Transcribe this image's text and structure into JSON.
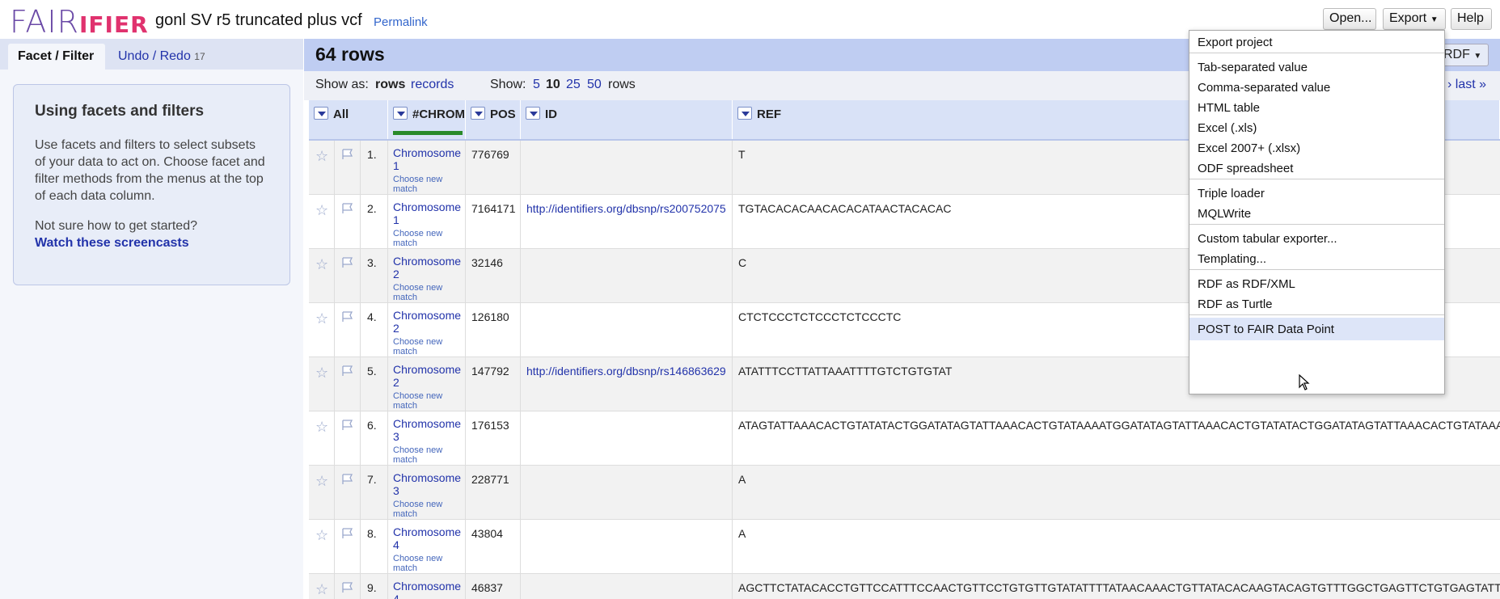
{
  "header": {
    "logo_fair": "FAIR",
    "logo_ifier": "IFIER",
    "project_title": "gonl SV r5 truncated plus vcf",
    "permalink": "Permalink",
    "open_label": "Open...",
    "export_label": "Export",
    "help_label": "Help"
  },
  "left": {
    "tab_facet": "Facet / Filter",
    "tab_undo": "Undo / Redo",
    "undo_count": "17",
    "help_title": "Using facets and filters",
    "help_body": "Use facets and filters to select subsets of your data to act on. Choose facet and filter methods from the menus at the top of each data column.",
    "help_question": "Not sure how to get started?",
    "help_link": "Watch these screencasts"
  },
  "grid": {
    "row_count": "64 rows",
    "rdf_button": "RDF",
    "show_as": "Show as:",
    "opt_rows": "rows",
    "opt_records": "records",
    "show": "Show:",
    "page_sizes": [
      "5",
      "10",
      "25",
      "50"
    ],
    "rows_label": "rows",
    "pager": "›  last »",
    "columns": [
      "All",
      "#CHROM",
      "POS",
      "ID",
      "REF"
    ],
    "choose_text": "Choose new match",
    "rows": [
      {
        "idx": "1.",
        "chrom": "Chromosome 1",
        "pos": "776769",
        "id": "",
        "ref": "T"
      },
      {
        "idx": "2.",
        "chrom": "Chromosome 1",
        "pos": "7164171",
        "id": "http://identifiers.org/dbsnp/rs200752075",
        "ref": "TGTACACACAACACACATAACTACACAC"
      },
      {
        "idx": "3.",
        "chrom": "Chromosome 2",
        "pos": "32146",
        "id": "",
        "ref": "C"
      },
      {
        "idx": "4.",
        "chrom": "Chromosome 2",
        "pos": "126180",
        "id": "",
        "ref": "CTCTCCCTCTCCCTCTCCCTC"
      },
      {
        "idx": "5.",
        "chrom": "Chromosome 2",
        "pos": "147792",
        "id": "http://identifiers.org/dbsnp/rs146863629",
        "ref": "ATATTTCCTTATTAAATTTTGTCTGTGTAT"
      },
      {
        "idx": "6.",
        "chrom": "Chromosome 3",
        "pos": "176153",
        "id": "",
        "ref": "ATAGTATTAAACACTGTATATACTGGATATAGTATTAAACACTGTATAAAATGGATATAGTATTAAACACTGTATATACTGGATATAGTATTAAACACTGTATAAA"
      },
      {
        "idx": "7.",
        "chrom": "Chromosome 3",
        "pos": "228771",
        "id": "",
        "ref": "A"
      },
      {
        "idx": "8.",
        "chrom": "Chromosome 4",
        "pos": "43804",
        "id": "",
        "ref": "A"
      },
      {
        "idx": "9.",
        "chrom": "Chromosome 4",
        "pos": "46837",
        "id": "",
        "ref": "AGCTTCTATACACCTGTTCCATTTCCAACTGTTCCTGTGTTGTATATTTTATAACAAACTGTTATACACAAGTACAGTGTTTGGCTGAGTTCTGTGAGTATT"
      }
    ]
  },
  "export_menu": {
    "items": [
      "Export project",
      "Tab-separated value",
      "Comma-separated value",
      "HTML table",
      "Excel (.xls)",
      "Excel 2007+ (.xlsx)",
      "ODF spreadsheet",
      "Triple loader",
      "MQLWrite",
      "Custom tabular exporter...",
      "Templating...",
      "RDF as RDF/XML",
      "RDF as Turtle",
      "POST to FAIR Data Point"
    ],
    "highlighted": "POST to FAIR Data Point"
  }
}
